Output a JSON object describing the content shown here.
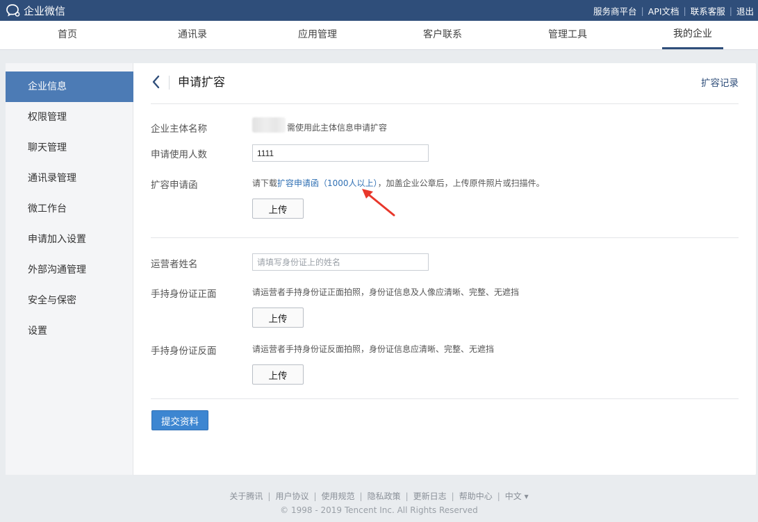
{
  "header": {
    "brand": "企业微信",
    "links": [
      "服务商平台",
      "API文档",
      "联系客服",
      "退出"
    ]
  },
  "nav": {
    "tabs": [
      "首页",
      "通讯录",
      "应用管理",
      "客户联系",
      "管理工具",
      "我的企业"
    ],
    "active": "我的企业"
  },
  "sidebar": {
    "items": [
      "企业信息",
      "权限管理",
      "聊天管理",
      "通讯录管理",
      "微工作台",
      "申请加入设置",
      "外部沟通管理",
      "安全与保密",
      "设置"
    ],
    "active": "企业信息"
  },
  "page": {
    "title": "申请扩容",
    "record_link": "扩容记录"
  },
  "form": {
    "entity_label": "企业主体名称",
    "entity_hint": "需使用此主体信息申请扩容",
    "users_label": "申请使用人数",
    "users_value": "1111",
    "letter_label": "扩容申请函",
    "letter_prefix": "请下载",
    "letter_link": "扩容申请函（1000人以上）",
    "letter_suffix": "，加盖企业公章后，上传原件照片或扫描件。",
    "upload_label": "上传",
    "operator_label": "运营者姓名",
    "operator_placeholder": "请填写身份证上的姓名",
    "id_front_label": "手持身份证正面",
    "id_front_hint": "请运营者手持身份证正面拍照，身份证信息及人像应清晰、完整、无遮挡",
    "id_back_label": "手持身份证反面",
    "id_back_hint": "请运营者手持身份证反面拍照，身份证信息应清晰、完整、无遮挡",
    "submit_label": "提交资料"
  },
  "footer": {
    "links": [
      "关于腾讯",
      "用户协议",
      "使用规范",
      "隐私政策",
      "更新日志",
      "帮助中心",
      "中文 ▾"
    ],
    "copyright": "© 1998 - 2019 Tencent Inc. All Rights Reserved"
  },
  "colors": {
    "topbar": "#2f4e7a",
    "sidebar_active": "#4c7bb5",
    "submit": "#3d86d1",
    "link": "#2f6fb3",
    "annotation_arrow": "#e8372b"
  }
}
